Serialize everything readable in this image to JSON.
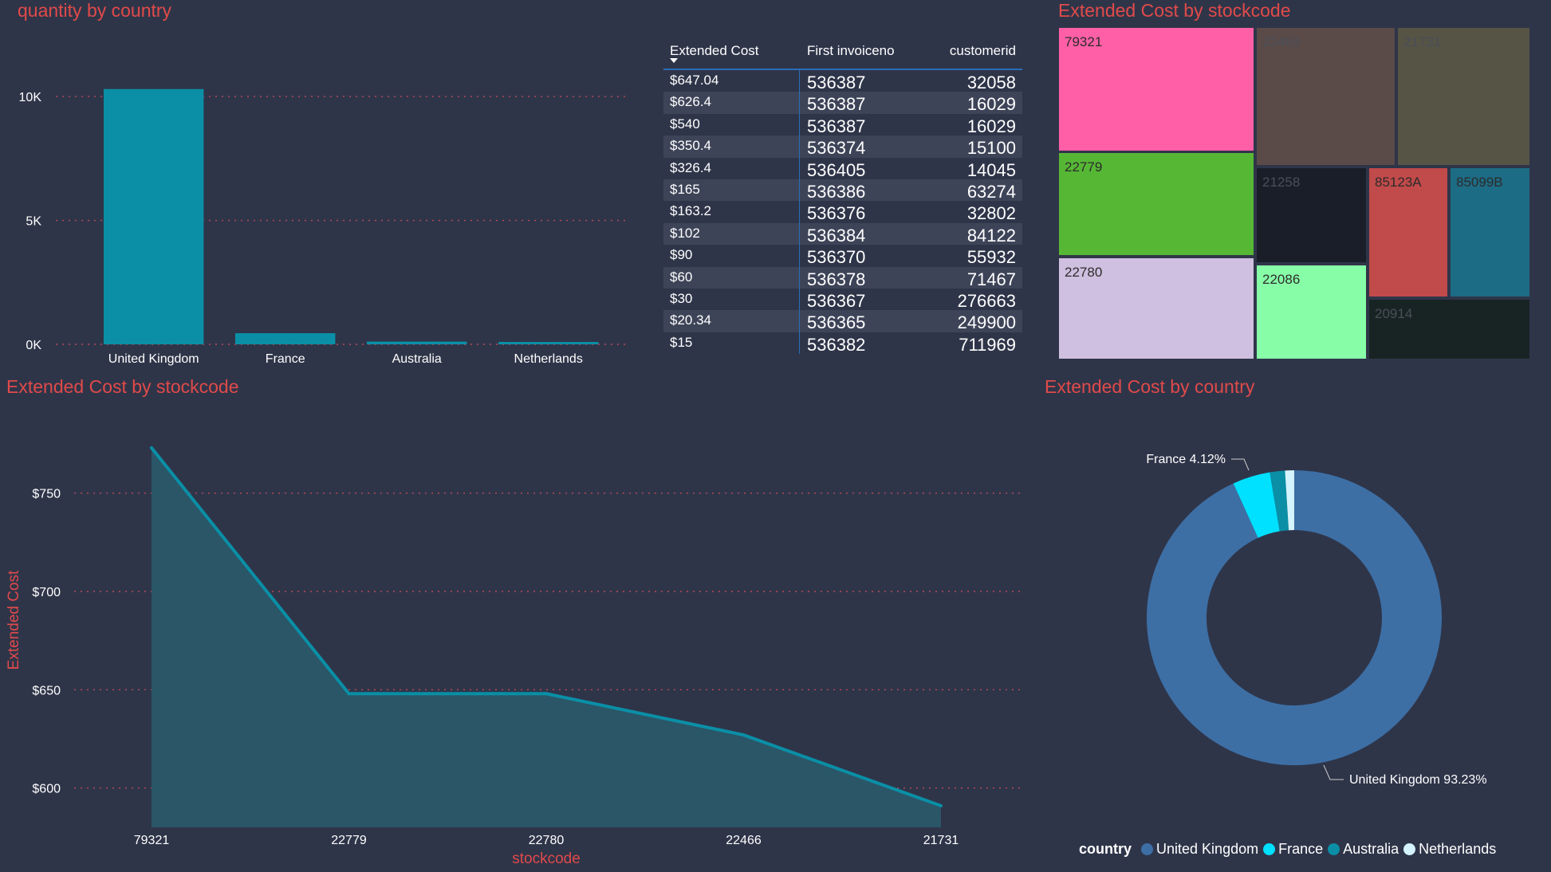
{
  "charts": {
    "bar": {
      "title": "quantity by country",
      "chart_data": {
        "type": "bar",
        "title": "quantity by country",
        "categories": [
          "United Kingdom",
          "France",
          "Australia",
          "Netherlands"
        ],
        "values": [
          10300,
          450,
          110,
          90
        ],
        "ylim": [
          0,
          11000
        ],
        "yticks": [
          0,
          5000,
          10000
        ],
        "ytick_labels": [
          "0K",
          "5K",
          "10K"
        ],
        "grid": true,
        "color": "#0a8fa6"
      }
    },
    "table": {
      "columns": [
        "Extended Cost",
        "First invoiceno",
        "customerid"
      ],
      "rows": [
        [
          "$647.04",
          "536387",
          "32058"
        ],
        [
          "$626.4",
          "536387",
          "16029"
        ],
        [
          "$540",
          "536387",
          "16029"
        ],
        [
          "$350.4",
          "536374",
          "15100"
        ],
        [
          "$326.4",
          "536405",
          "14045"
        ],
        [
          "$165",
          "536386",
          "63274"
        ],
        [
          "$163.2",
          "536376",
          "32802"
        ],
        [
          "$102",
          "536384",
          "84122"
        ],
        [
          "$90",
          "536370",
          "55932"
        ],
        [
          "$60",
          "536378",
          "71467"
        ],
        [
          "$30",
          "536367",
          "276663"
        ],
        [
          "$20.34",
          "536365",
          "249900"
        ],
        [
          "$15",
          "536382",
          "711969"
        ]
      ]
    },
    "treemap": {
      "title": "Extended Cost by stockcode",
      "chart_data": {
        "type": "treemap",
        "title": "Extended Cost by stockcode",
        "items": [
          {
            "label": "79321",
            "color": "#fe5fa6"
          },
          {
            "label": "22466",
            "color": "#5a4a48"
          },
          {
            "label": "21731",
            "color": "#565445"
          },
          {
            "label": "22779",
            "color": "#56b735"
          },
          {
            "label": "21258",
            "color": "#1a1e28"
          },
          {
            "label": "85123A",
            "color": "#c14a4a"
          },
          {
            "label": "85099B",
            "color": "#1d6c85"
          },
          {
            "label": "22780",
            "color": "#cfbfe0"
          },
          {
            "label": "22086",
            "color": "#88fda8"
          },
          {
            "label": "20914",
            "color": "#182424"
          }
        ]
      }
    },
    "area": {
      "title": "Extended Cost by stockcode",
      "chart_data": {
        "type": "area",
        "title": "Extended Cost by stockcode",
        "categories": [
          "79321",
          "22779",
          "22780",
          "22466",
          "21731"
        ],
        "values": [
          773,
          648,
          648,
          627,
          591
        ],
        "xlabel": "stockcode",
        "ylabel": "Extended Cost",
        "ylim": [
          580,
          790
        ],
        "yticks": [
          600,
          650,
          700,
          750
        ],
        "ytick_labels": [
          "$600",
          "$650",
          "$700",
          "$750"
        ],
        "grid": true,
        "color": "#0a8fa6"
      }
    },
    "donut": {
      "title": "Extended Cost by country",
      "chart_data": {
        "type": "pie",
        "title": "Extended Cost by country",
        "categories": [
          "United Kingdom",
          "France",
          "Australia",
          "Netherlands"
        ],
        "values": [
          93.23,
          4.12,
          1.65,
          1.0
        ],
        "colors": [
          "#3d6fa5",
          "#00e0ff",
          "#0a8fa6",
          "#d4f4ff"
        ],
        "data_labels": [
          "United Kingdom 93.23%",
          "France 4.12%"
        ],
        "legend_title": "country",
        "legend_position": "bottom"
      }
    }
  }
}
